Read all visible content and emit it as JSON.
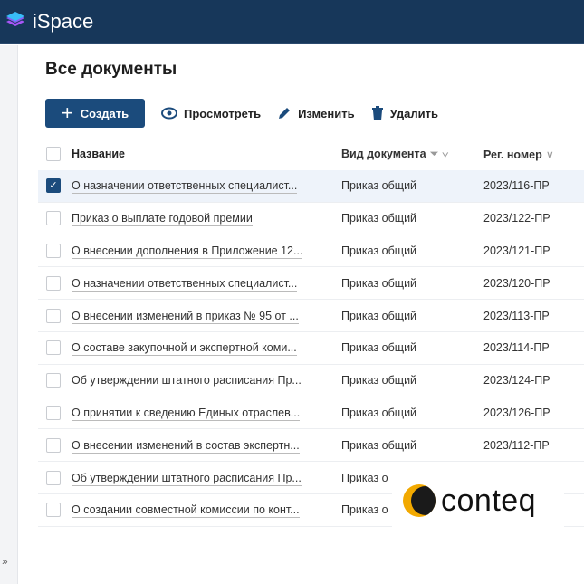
{
  "app": {
    "title": "iSpace"
  },
  "page": {
    "title": "Все документы"
  },
  "toolbar": {
    "create": "Создать",
    "view": "Просмотреть",
    "edit": "Изменить",
    "delete": "Удалить"
  },
  "columns": {
    "name": "Название",
    "kind": "Вид документа",
    "reg": "Рег. номер"
  },
  "rows": [
    {
      "name": "О назначении ответственных специалист...",
      "kind": "Приказ общий",
      "reg": "2023/116-ПР",
      "checked": true
    },
    {
      "name": "Приказ о выплате годовой премии",
      "kind": "Приказ общий",
      "reg": "2023/122-ПР"
    },
    {
      "name": "О внесении дополнения в Приложение 12...",
      "kind": "Приказ общий",
      "reg": "2023/121-ПР"
    },
    {
      "name": "О назначении ответственных специалист...",
      "kind": "Приказ общий",
      "reg": "2023/120-ПР"
    },
    {
      "name": "О внесении изменений в приказ № 95 от ...",
      "kind": "Приказ общий",
      "reg": "2023/113-ПР"
    },
    {
      "name": "О составе закупочной и экспертной коми...",
      "kind": "Приказ общий",
      "reg": "2023/114-ПР"
    },
    {
      "name": "Об утверждении штатного расписания Пр...",
      "kind": "Приказ общий",
      "reg": "2023/124-ПР"
    },
    {
      "name": "О принятии к сведению Единых отраслев...",
      "kind": "Приказ общий",
      "reg": "2023/126-ПР"
    },
    {
      "name": "О внесении изменений в состав экспертн...",
      "kind": "Приказ общий",
      "reg": "2023/112-ПР"
    },
    {
      "name": "Об утверждении штатного расписания Пр...",
      "kind": "Приказ о",
      "reg": ""
    },
    {
      "name": "О создании совместной комиссии по конт...",
      "kind": "Приказ о",
      "reg": ""
    }
  ],
  "watermark": {
    "brand": "conteq"
  },
  "sidebar": {
    "expand": "»"
  }
}
